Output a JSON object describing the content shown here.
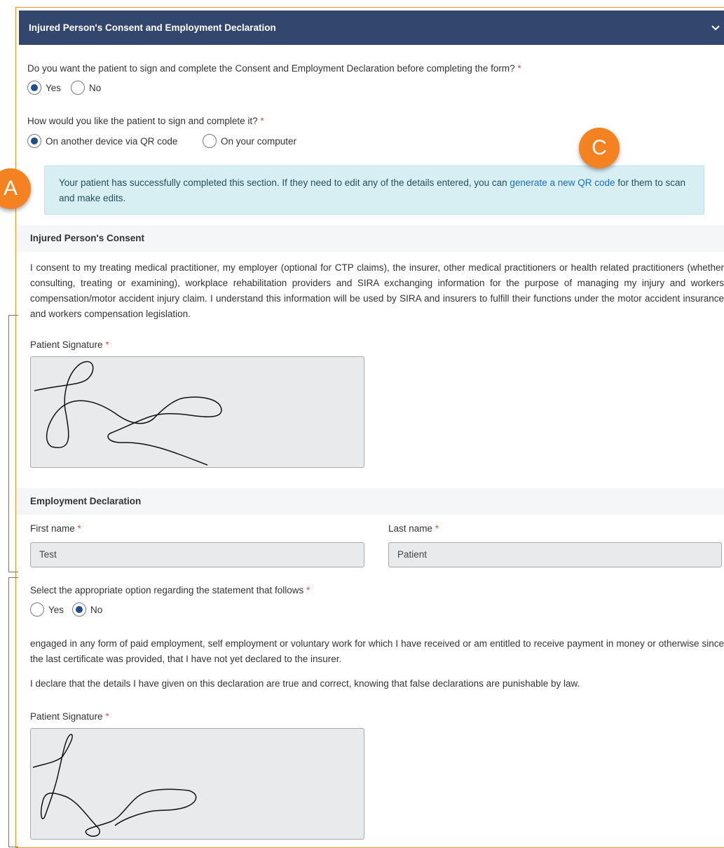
{
  "header": {
    "title": "Injured Person's Consent and Employment Declaration",
    "icon": "chevron-down-icon"
  },
  "q1": {
    "label": "Do you want the patient to sign and complete the Consent and Employment Declaration before completing the form?",
    "required": "*",
    "options": [
      "Yes",
      "No"
    ],
    "selected": "Yes"
  },
  "q2": {
    "label": "How would you like the patient to sign and complete it?",
    "required": "*",
    "options": [
      "On another device via QR code",
      "On your computer"
    ],
    "selected": "On another device via QR code"
  },
  "info": {
    "text_before": "Your patient has successfully completed this section. If they need to edit any of the details entered, you can ",
    "link": "generate a new QR code",
    "text_after": " for them to scan and make edits."
  },
  "consent": {
    "title": "Injured Person's Consent",
    "text": "I consent to my treating medical practitioner, my employer (optional for CTP claims), the insurer, other medical practitioners or health related practitioners (whether consulting, treating or examining), workplace rehabilitation providers and SIRA exchanging information for the purpose of managing my injury and workers compensation/motor accident injury claim. I understand this information will be used by SIRA and insurers to fulfill their functions under the motor accident insurance and workers compensation legislation.",
    "signature_label": "Patient Signature",
    "required": "*"
  },
  "employment": {
    "title": "Employment Declaration",
    "first_name_label": "First name",
    "first_name_value": "Test",
    "last_name_label": "Last name",
    "last_name_value": "Patient",
    "required": "*",
    "statement_label": "Select the appropriate option regarding the statement that follows",
    "options": [
      "Yes",
      "No"
    ],
    "selected": "No",
    "statement_text": "engaged in any form of paid employment, self employment or voluntary work for which I have received or am entitled to receive payment in money or otherwise since the last certificate was provided, that I have not yet declared to the insurer.",
    "declaration_text": "I declare that the details I have given on this declaration are true and correct, knowing that false declarations are punishable by law.",
    "signature_label": "Patient Signature"
  },
  "annotations": {
    "a": "A",
    "c": "C"
  },
  "colors": {
    "header_bg": "#32466e",
    "accent_orange": "#f58220",
    "info_bg": "#d7eef3",
    "link": "#1b6fc0",
    "required": "#d9534f"
  }
}
